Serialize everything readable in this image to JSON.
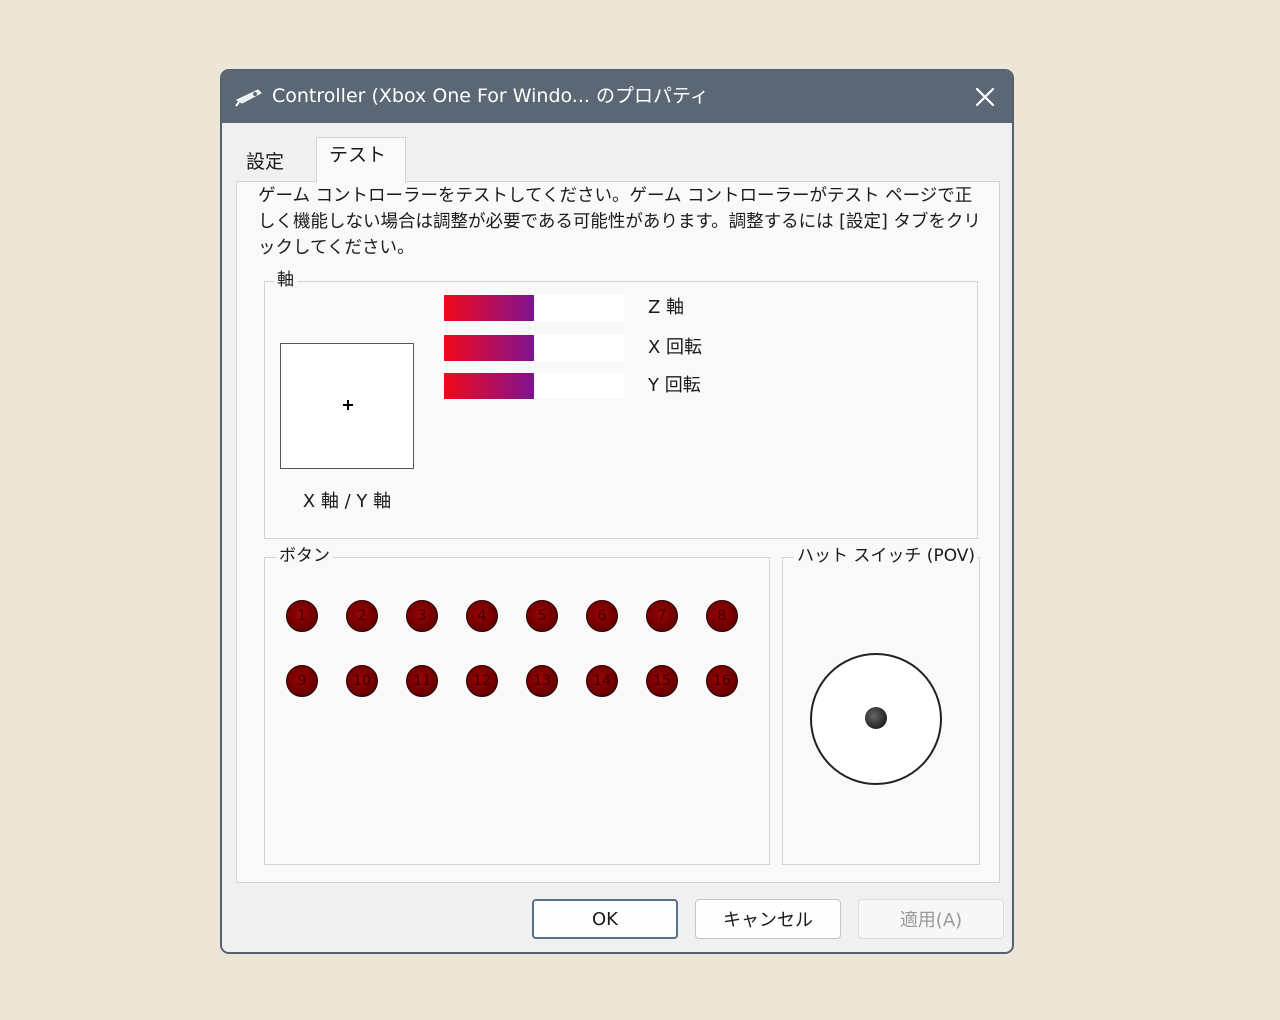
{
  "window": {
    "title": "Controller (Xbox One For Windo... のプロパティ",
    "icon": "game-controller-icon",
    "close_icon": "close-icon"
  },
  "tabs": [
    {
      "label": "設定",
      "active": false
    },
    {
      "label": "テスト",
      "active": true
    }
  ],
  "description": "ゲーム コントローラーをテストしてください。ゲーム コントローラーがテスト ページで正しく機能しない場合は調整が必要である可能性があります。調整するには [設定] タブをクリックしてください。",
  "axes": {
    "group_label": "軸",
    "xy_label": "X 軸 / Y 軸",
    "bars": [
      {
        "label": "Z 軸",
        "level": 0.5
      },
      {
        "label": "X 回転",
        "level": 0.5
      },
      {
        "label": "Y 回転",
        "level": 0.5
      }
    ]
  },
  "buttons": {
    "group_label": "ボタン",
    "labels": [
      "1",
      "2",
      "3",
      "4",
      "5",
      "6",
      "7",
      "8",
      "9",
      "10",
      "11",
      "12",
      "13",
      "14",
      "15",
      "16"
    ]
  },
  "pov": {
    "group_label": "ハット スイッチ (POV)"
  },
  "footer": {
    "ok_label": "OK",
    "cancel_label": "キャンセル",
    "apply_label": "適用(A)"
  },
  "colors": {
    "titlebar": "#5b6775",
    "bar_gradient_start": "#f2091a",
    "bar_gradient_end": "#7e1391",
    "button_indicator": "#7a0000"
  }
}
